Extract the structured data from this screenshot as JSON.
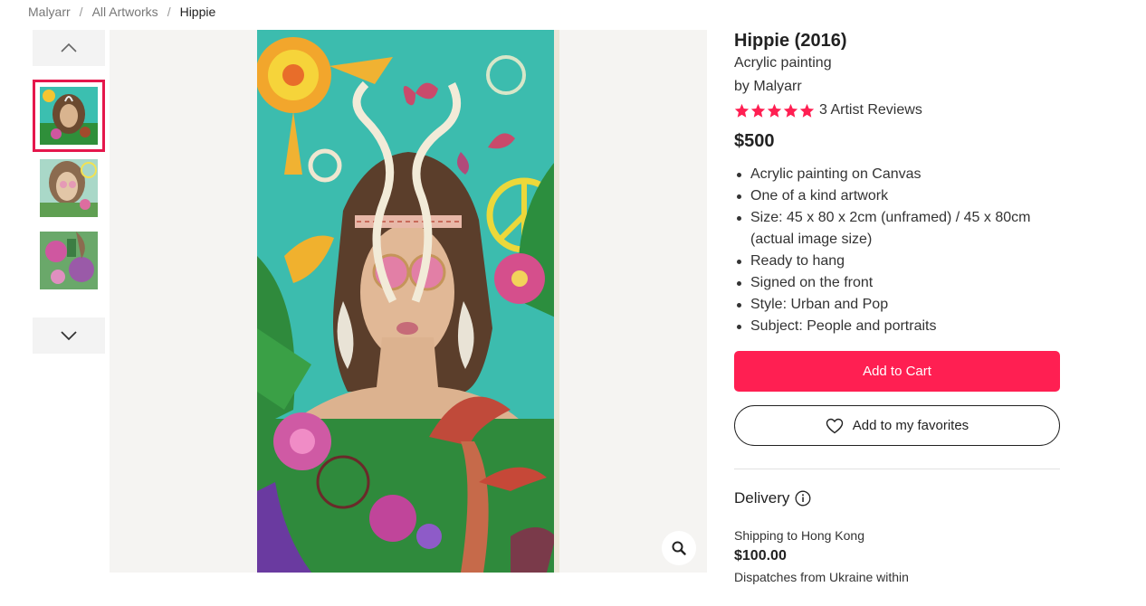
{
  "breadcrumb": {
    "items": [
      "Malyarr",
      "All Artworks",
      "Hippie"
    ],
    "separator": "/"
  },
  "gallery": {
    "thumbnails": [
      "thumbnail-1",
      "thumbnail-2",
      "thumbnail-3"
    ],
    "active_index": 0,
    "up_icon": "chevron-up-icon",
    "down_icon": "chevron-down-icon",
    "zoom_icon": "magnifier-icon"
  },
  "product": {
    "title": "Hippie (2016)",
    "medium": "Acrylic painting",
    "artist_prefix": "by",
    "artist": "Malyarr",
    "rating": 5,
    "reviews_label": "3 Artist Reviews",
    "price": "$500",
    "features": [
      "Acrylic painting on Canvas",
      "One of a kind artwork",
      "Size: 45 x 80 x 2cm (unframed) / 45 x 80cm (actual image size)",
      "Ready to hang",
      "Signed on the front",
      "Style: Urban and Pop",
      "Subject: People and portraits"
    ]
  },
  "actions": {
    "add_to_cart": "Add to Cart",
    "add_to_favorites": "Add to my favorites"
  },
  "delivery": {
    "heading": "Delivery",
    "shipping_to": "Shipping to Hong Kong",
    "shipping_price": "$100.00",
    "dispatch": "Dispatches from Ukraine within"
  },
  "colors": {
    "accent": "#ff1f52",
    "thumb_border": "#e5174c",
    "viewer_bg": "#f5f4f2"
  }
}
